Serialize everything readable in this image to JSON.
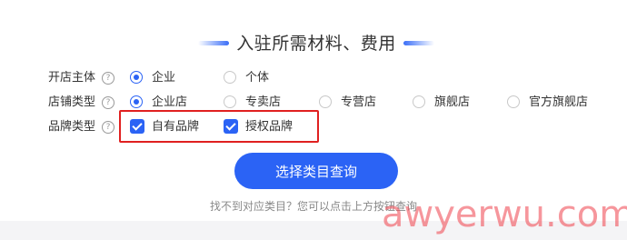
{
  "title": "入驻所需材料、费用",
  "rows": {
    "subject": {
      "label": "开店主体",
      "help_icon": "question-circle-icon",
      "options": [
        {
          "label": "企业",
          "checked": true
        },
        {
          "label": "个体",
          "checked": false
        }
      ]
    },
    "shop_type": {
      "label": "店铺类型",
      "help_icon": "question-circle-icon",
      "options": [
        {
          "label": "企业店",
          "checked": true
        },
        {
          "label": "专卖店",
          "checked": false
        },
        {
          "label": "专营店",
          "checked": false
        },
        {
          "label": "旗舰店",
          "checked": false
        },
        {
          "label": "官方旗舰店",
          "checked": false
        }
      ]
    },
    "brand_type": {
      "label": "品牌类型",
      "help_icon": "question-circle-icon",
      "options": [
        {
          "label": "自有品牌",
          "checked": true
        },
        {
          "label": "授权品牌",
          "checked": true
        }
      ]
    }
  },
  "query_button": "选择类目查询",
  "hint": "找不到对应类目？您可以点击上方按钮查询",
  "watermark": "awyerwu.com",
  "colors": {
    "accent": "#2b63f5",
    "highlight": "#e02020"
  }
}
